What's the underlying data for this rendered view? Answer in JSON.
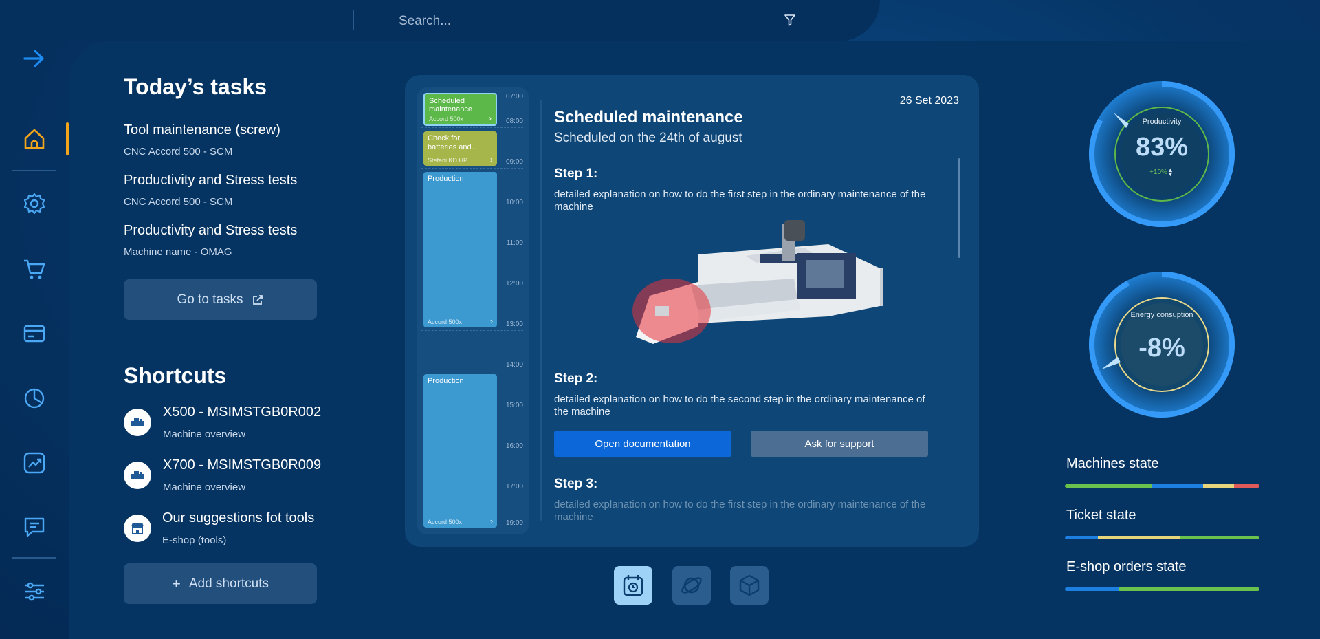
{
  "search": {
    "placeholder": "Search..."
  },
  "tasks": {
    "title": "Today’s tasks",
    "items": [
      {
        "title": "Tool maintenance (screw)",
        "subtitle": "CNC Accord 500 - SCM"
      },
      {
        "title": "Productivity and Stress tests",
        "subtitle": "CNC Accord 500 - SCM"
      },
      {
        "title": "Productivity and Stress tests",
        "subtitle": "Machine name - OMAG"
      }
    ],
    "go_button": "Go to tasks"
  },
  "shortcuts": {
    "title": "Shortcuts",
    "items": [
      {
        "title": "X500 - MSIMSTGB0R002",
        "subtitle": "Machine overview",
        "icon": "machine-icon"
      },
      {
        "title": "X700 - MSIMSTGB0R009",
        "subtitle": "Machine overview",
        "icon": "machine-icon"
      },
      {
        "title": "Our suggestions fot tools",
        "subtitle": "E-shop (tools)",
        "icon": "shop-icon"
      }
    ],
    "add_button": "Add shortcuts"
  },
  "timeline": {
    "hours": [
      "07:00",
      "08:00",
      "09:00",
      "10:00",
      "11:00",
      "12:00",
      "13:00",
      "14:00",
      "15:00",
      "16:00",
      "17:00",
      "19:00"
    ],
    "events": [
      {
        "title": "Scheduled maintenance",
        "machine": "Accord 500x",
        "color": "#5db84a"
      },
      {
        "title": "Check for batteries and..",
        "machine": "Stefani KD HP",
        "color": "#a6b64a"
      },
      {
        "title": "Production",
        "machine": "Accord 500x",
        "color": "#3d9ad1"
      },
      {
        "title": "Production",
        "machine": "Accord 500x",
        "color": "#3d9ad1"
      }
    ]
  },
  "detail": {
    "date": "26 Set 2023",
    "title": "Scheduled maintenance",
    "subtitle": "Scheduled on the 24th of august",
    "steps": [
      {
        "heading": "Step 1:",
        "text": "detailed explanation on how to do the first step in the ordinary maintenance of the machine"
      },
      {
        "heading": "Step 2:",
        "text": "detailed explanation on how to do the second step in the ordinary maintenance of the machine"
      },
      {
        "heading": "Step 3:",
        "text": "detailed explanation on how to do the first step in the ordinary maintenance of the machine"
      }
    ],
    "open_doc_button": "Open documentation",
    "support_button": "Ask for support"
  },
  "gauges": {
    "productivity": {
      "label": "Productivity",
      "value": "83%",
      "delta": "+10%",
      "level": 0.83,
      "color": "#5db84a"
    },
    "energy": {
      "label": "Energy consuption",
      "value": "-8%",
      "level": 0.92,
      "color": "#e9d98a"
    }
  },
  "states": {
    "machines": {
      "label": "Machines state",
      "segments": [
        {
          "color": "#6ac14b",
          "frac": 0.45
        },
        {
          "color": "#1d7fe0",
          "frac": 0.26
        },
        {
          "color": "#e8d47a",
          "frac": 0.16
        },
        {
          "color": "#e05a5a",
          "frac": 0.13
        }
      ]
    },
    "tickets": {
      "label": "Ticket state",
      "segments": [
        {
          "color": "#1d7fe0",
          "frac": 0.17
        },
        {
          "color": "#e8d47a",
          "frac": 0.42
        },
        {
          "color": "#6ac14b",
          "frac": 0.41
        }
      ]
    },
    "eshop": {
      "label": "E-shop orders state",
      "segments": [
        {
          "color": "#1d7fe0",
          "frac": 0.28
        },
        {
          "color": "#6ac14b",
          "frac": 0.72
        }
      ]
    }
  },
  "colors": {
    "accent": "#f2a51a",
    "primary_button": "#0c68d8",
    "nav_icon": "#4aa8f5"
  }
}
